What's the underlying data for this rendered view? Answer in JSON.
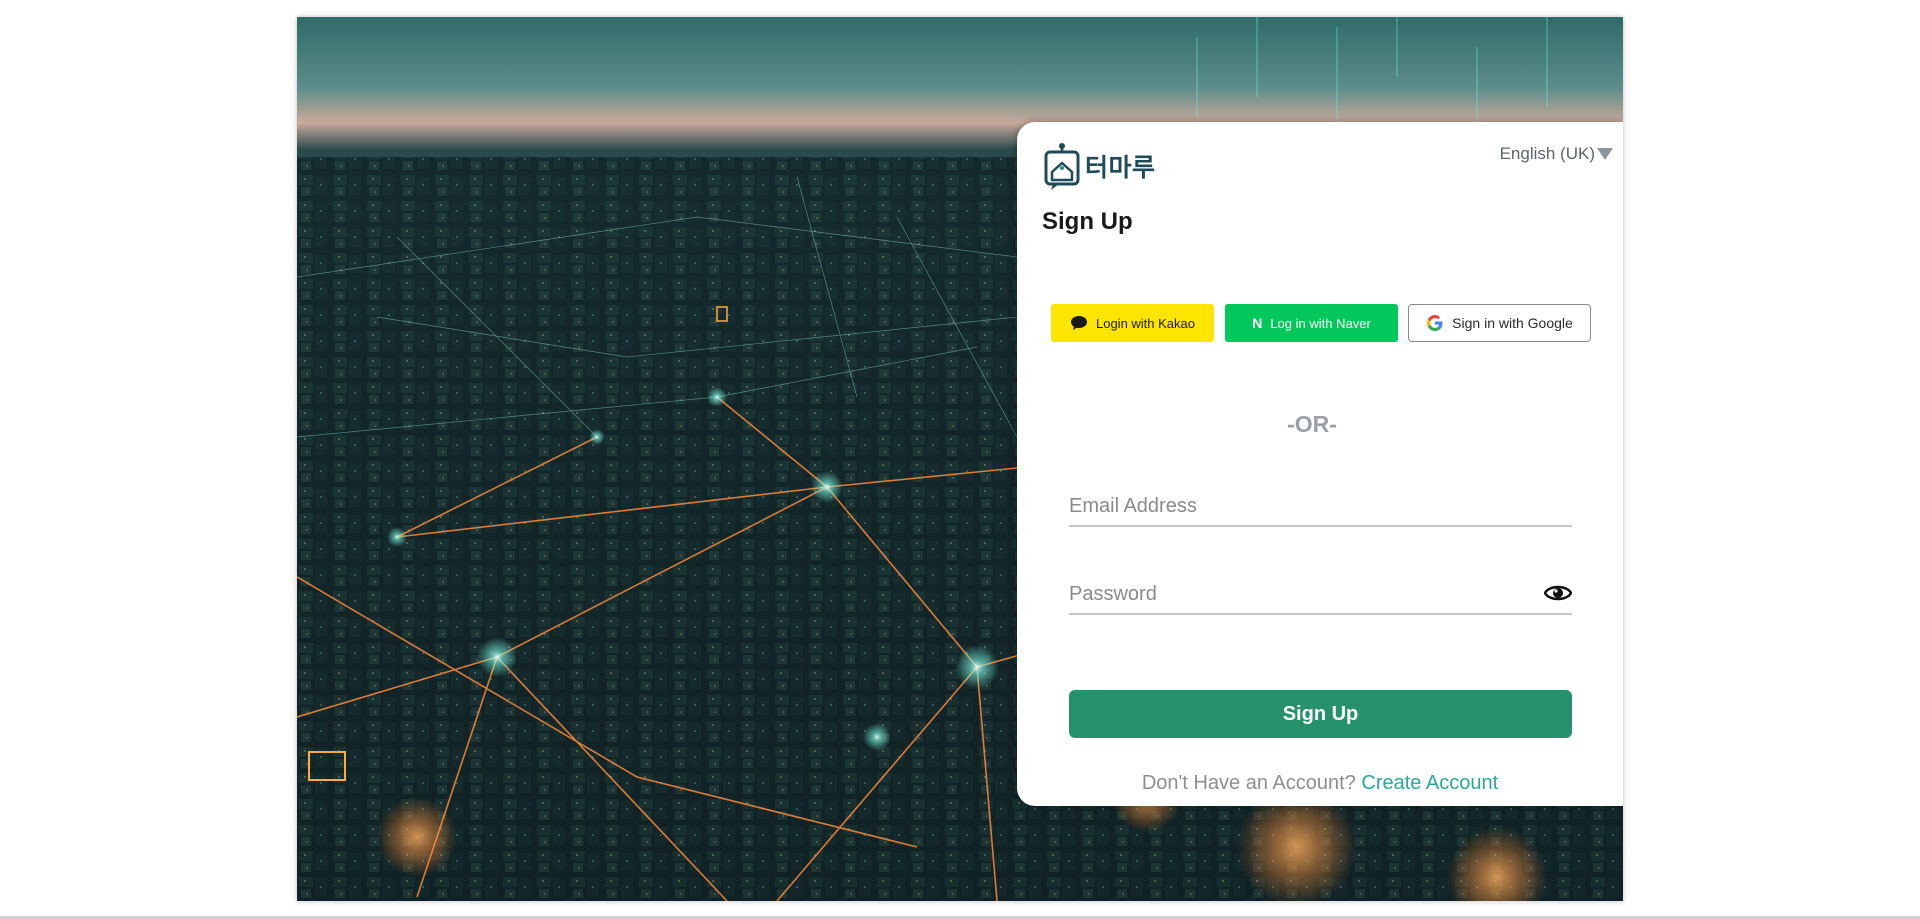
{
  "logo": {
    "text": "터마루",
    "icon": "home-chat-icon"
  },
  "language": {
    "selected": "English (UK)",
    "icon": "caret-down-icon"
  },
  "title": "Sign Up",
  "social": {
    "kakao": {
      "label": "Login with Kakao",
      "icon": "chat-bubble-icon",
      "color": "#fee500"
    },
    "naver": {
      "label": "Log in with Naver",
      "icon": "naver-n-icon",
      "mark": "N",
      "color": "#03c75a"
    },
    "google": {
      "label": "Sign in with Google",
      "icon": "google-g-icon"
    }
  },
  "divider": "-OR-",
  "form": {
    "email_placeholder": "Email Address",
    "password_placeholder": "Password",
    "password_toggle_icon": "eye-icon",
    "submit_label": "Sign Up"
  },
  "footer": {
    "prompt": "Don't Have an Account?",
    "link": "Create Account"
  },
  "colors": {
    "accent": "#27916b",
    "link": "#2aa79b",
    "logo": "#1f4b59"
  },
  "background": {
    "description_icon": "city-network-background"
  }
}
